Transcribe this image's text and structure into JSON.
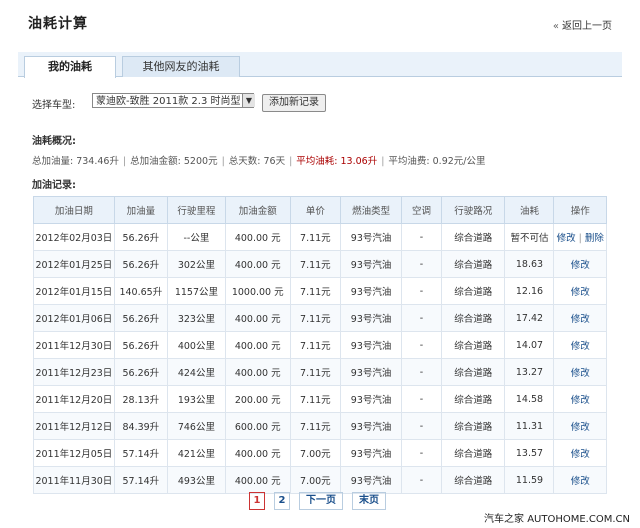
{
  "header": {
    "title": "油耗计算",
    "back_label": "返回上一页"
  },
  "tabs": [
    {
      "label": "我的油耗"
    },
    {
      "label": "其他网友的油耗"
    }
  ],
  "car_select": {
    "label": "选择车型:",
    "value": "蒙迪欧-致胜 2011款 2.3 时尚型",
    "add_button": "添加新记录"
  },
  "overview": {
    "heading": "油耗概况:",
    "total_fuel": "总加油量: 734.46升",
    "total_amount": "总加油金额: 5200元",
    "total_days": "总天数: 76天",
    "avg_consumption": "平均油耗: 13.06升",
    "avg_cost": "平均油费: 0.92元/公里"
  },
  "records": {
    "heading": "加油记录:",
    "columns": [
      "加油日期",
      "加油量",
      "行驶里程",
      "加油金额",
      "单价",
      "燃油类型",
      "空调",
      "行驶路况",
      "油耗",
      "操作"
    ],
    "rows": [
      [
        "2012年02月03日",
        "56.26升",
        "--公里",
        "400.00 元",
        "7.11元",
        "93号汽油",
        "-",
        "综合道路",
        "暂不可估",
        "修改",
        "删除"
      ],
      [
        "2012年01月25日",
        "56.26升",
        "302公里",
        "400.00 元",
        "7.11元",
        "93号汽油",
        "-",
        "综合道路",
        "18.63",
        "修改",
        ""
      ],
      [
        "2012年01月15日",
        "140.65升",
        "1157公里",
        "1000.00 元",
        "7.11元",
        "93号汽油",
        "-",
        "综合道路",
        "12.16",
        "修改",
        ""
      ],
      [
        "2012年01月06日",
        "56.26升",
        "323公里",
        "400.00 元",
        "7.11元",
        "93号汽油",
        "-",
        "综合道路",
        "17.42",
        "修改",
        ""
      ],
      [
        "2011年12月30日",
        "56.26升",
        "400公里",
        "400.00 元",
        "7.11元",
        "93号汽油",
        "-",
        "综合道路",
        "14.07",
        "修改",
        ""
      ],
      [
        "2011年12月23日",
        "56.26升",
        "424公里",
        "400.00 元",
        "7.11元",
        "93号汽油",
        "-",
        "综合道路",
        "13.27",
        "修改",
        ""
      ],
      [
        "2011年12月20日",
        "28.13升",
        "193公里",
        "200.00 元",
        "7.11元",
        "93号汽油",
        "-",
        "综合道路",
        "14.58",
        "修改",
        ""
      ],
      [
        "2011年12月12日",
        "84.39升",
        "746公里",
        "600.00 元",
        "7.11元",
        "93号汽油",
        "-",
        "综合道路",
        "11.31",
        "修改",
        ""
      ],
      [
        "2011年12月05日",
        "57.14升",
        "421公里",
        "400.00 元",
        "7.00元",
        "93号汽油",
        "-",
        "综合道路",
        "13.57",
        "修改",
        ""
      ],
      [
        "2011年11月30日",
        "57.14升",
        "493公里",
        "400.00 元",
        "7.00元",
        "93号汽油",
        "-",
        "综合道路",
        "11.59",
        "修改",
        ""
      ]
    ]
  },
  "pagination": {
    "pages": [
      "1",
      "2"
    ],
    "current": "1",
    "next": "下一页",
    "last": "末页"
  },
  "watermark": "汽车之家 AUTOHOME.COM.CN"
}
